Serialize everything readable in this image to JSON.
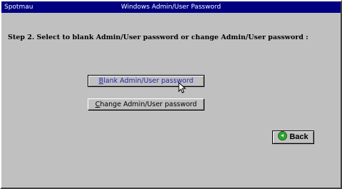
{
  "window": {
    "app_name": "Spotmau",
    "title": "Windows Admin/User Password"
  },
  "main": {
    "instruction": "Step 2. Select to blank Admin/User password or change Admin/User password :"
  },
  "buttons": {
    "blank_first": "B",
    "blank_rest": "lank Admin/User password",
    "change_first": "C",
    "change_rest": "hange Admin/User password",
    "back_label": "Back"
  },
  "icons": {
    "back": "back-arrow-icon",
    "cursor": "mouse-pointer-icon"
  },
  "colors": {
    "titlebar": "#000080",
    "face": "#c0c0c0",
    "blank_button_text": "#2424b0",
    "back_icon": "#2fa22f"
  }
}
